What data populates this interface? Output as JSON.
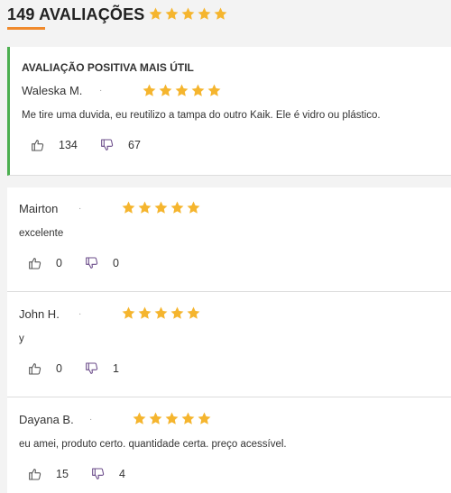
{
  "header": {
    "title": "149 AVALIAÇÕES",
    "rating": 5,
    "accent_color": "#f08a2c"
  },
  "colors": {
    "star": "#f5b52e",
    "helpful_border": "#4caf50",
    "thumb_up": "#555555",
    "thumb_down": "#6b4c8a"
  },
  "helpful_review": {
    "label": "AVALIAÇÃO POSITIVA MAIS ÚTIL",
    "author": "Waleska M.",
    "separator": "·",
    "rating": 5,
    "text": "Me tire uma duvida, eu reutilizo a tampa do outro Kaik. Ele é vidro ou plástico.",
    "likes": "134",
    "dislikes": "67"
  },
  "reviews": [
    {
      "author": "Mairton",
      "separator": "·",
      "rating": 5,
      "text": "excelente",
      "likes": "0",
      "dislikes": "0"
    },
    {
      "author": "John H.",
      "separator": "·",
      "rating": 5,
      "text": "y",
      "likes": "0",
      "dislikes": "1"
    },
    {
      "author": "Dayana B.",
      "separator": "·",
      "rating": 5,
      "text": "eu amei, produto certo. quantidade certa. preço acessível.",
      "likes": "15",
      "dislikes": "4"
    }
  ]
}
